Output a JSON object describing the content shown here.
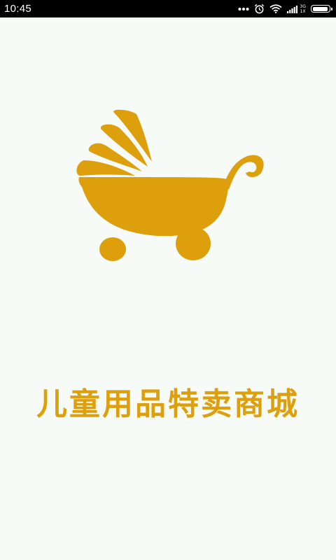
{
  "status_bar": {
    "time": "10:45",
    "network_top": "3G",
    "network_bottom": "1X",
    "icons": [
      "more-dots-icon",
      "alarm-icon",
      "wifi-icon",
      "signal-icon",
      "battery-icon"
    ],
    "battery_level": 0.95
  },
  "splash": {
    "logo_icon": "baby-stroller-icon",
    "title": "儿童用品特卖商城",
    "colors": {
      "brand": "#de9f0d",
      "background": "#f7fbf7",
      "status_bar": "#000000"
    }
  }
}
